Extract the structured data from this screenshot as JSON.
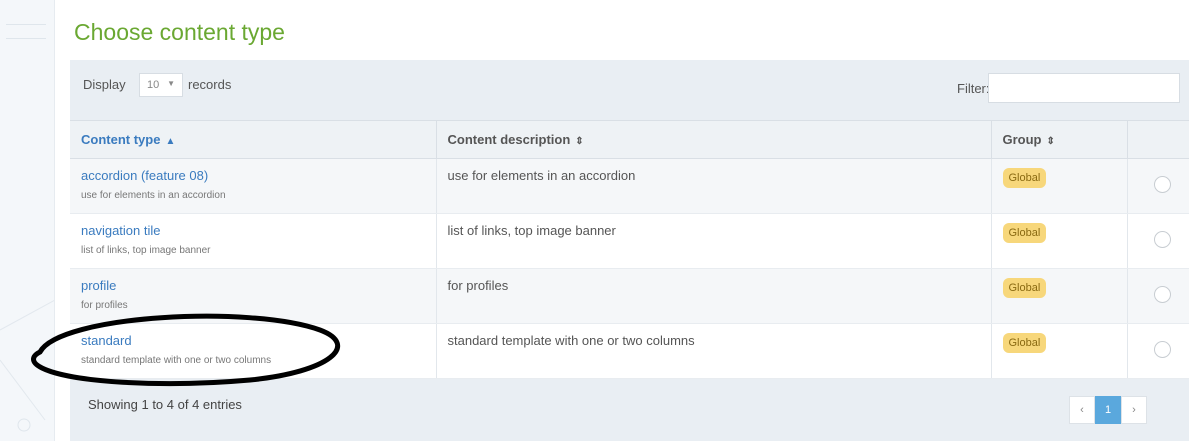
{
  "page": {
    "title": "Choose content type"
  },
  "toolbar": {
    "display_label": "Display",
    "page_size": "10",
    "records_label": "records",
    "filter_label": "Filter:",
    "filter_value": ""
  },
  "table": {
    "headers": [
      "Content type",
      "Content description",
      "Group",
      ""
    ],
    "sort_column": "Content type",
    "rows": [
      {
        "name": "accordion (feature 08)",
        "sub": "use for elements in an accordion",
        "description": "use for elements in an accordion",
        "group": "Global",
        "selected": false
      },
      {
        "name": "navigation tile",
        "sub": "list of links, top image banner",
        "description": "list of links, top image banner",
        "group": "Global",
        "selected": false
      },
      {
        "name": "profile",
        "sub": "for profiles",
        "description": "for profiles",
        "group": "Global",
        "selected": false
      },
      {
        "name": "standard",
        "sub": "standard template with one or two columns",
        "description": "standard template with one or two columns",
        "group": "Global",
        "selected": false
      }
    ]
  },
  "footer": {
    "entries_info": "Showing 1 to 4 of 4 entries",
    "pager": {
      "prev": "‹",
      "current": "1",
      "next": "›"
    }
  },
  "icons": {
    "sort_ascending": "sort-ascending-icon",
    "sort_both": "sort-both-icon",
    "caret": "caret-down-icon"
  },
  "colors": {
    "title": "#6aa832",
    "link": "#3a7bbf",
    "badge": "#f7d77b",
    "pager_active": "#5aa8dd",
    "annotation": "#000000"
  }
}
